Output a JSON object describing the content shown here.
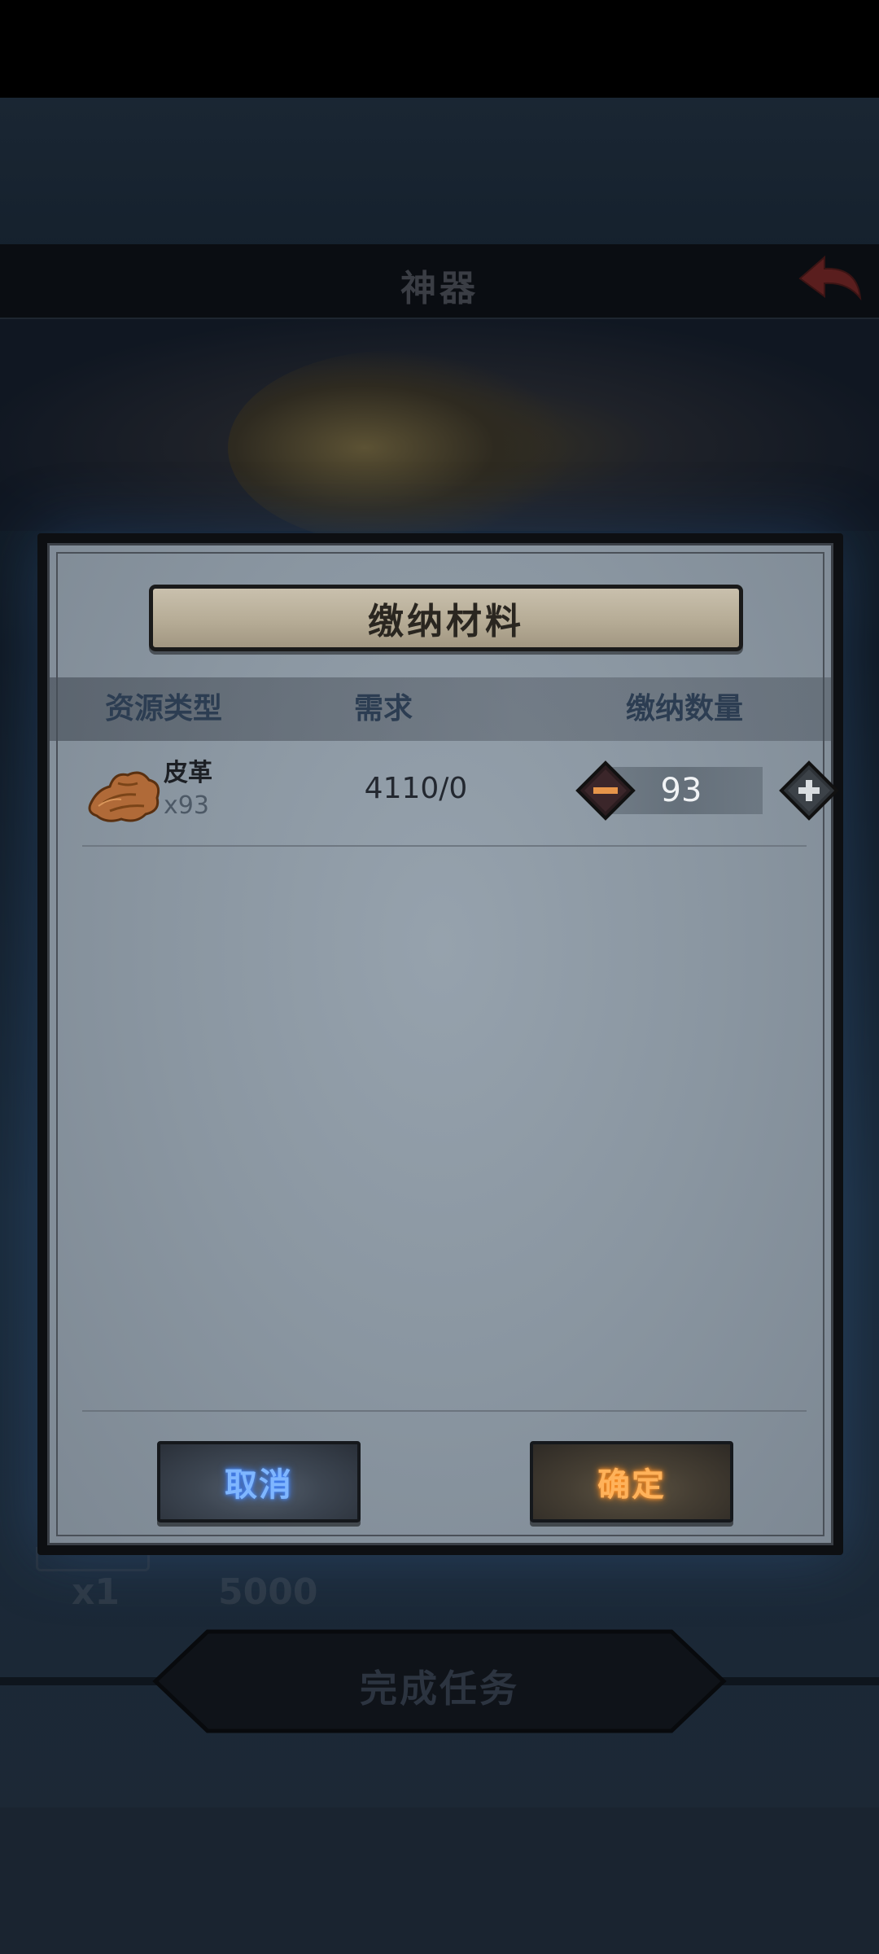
{
  "background": {
    "title": "神器",
    "reward_quantity": "x1",
    "reward_value": "5000",
    "complete_button_label": "完成任务"
  },
  "dialog": {
    "title": "缴纳材料",
    "columns": {
      "resource_type": "资源类型",
      "requirement": "需求",
      "submit_quantity": "缴纳数量"
    },
    "items": [
      {
        "name": "皮革",
        "owned": "x93",
        "requirement": "4110/0",
        "submit_quantity": "93",
        "icon": "leather-icon"
      }
    ],
    "cancel_label": "取消",
    "confirm_label": "确定"
  },
  "colors": {
    "cancel_text": "#7fb6ff",
    "confirm_text": "#ffb25a",
    "header_text": "#2c3d52",
    "panel": "#8a96a1"
  }
}
